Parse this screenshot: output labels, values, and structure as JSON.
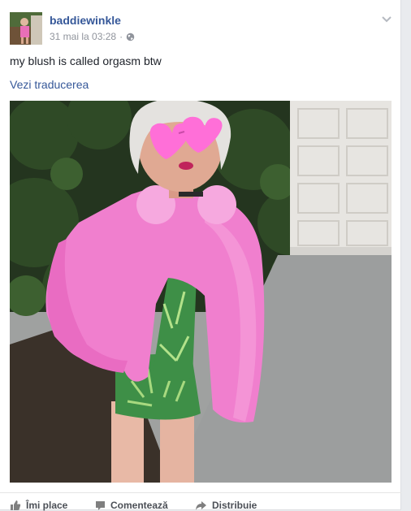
{
  "post": {
    "author": "baddiewinkle",
    "timestamp": "31 mai la 03:28",
    "separator": "·",
    "privacy_icon": "globe-icon",
    "menu_icon": "chevron-down-icon",
    "text": "my blush is called orgasm btw",
    "translate_link": "Vezi traducerea"
  },
  "actions": {
    "like_label": "Îmi place",
    "comment_label": "Comentează",
    "share_label": "Distribuie"
  },
  "colors": {
    "link": "#365899",
    "meta": "#90949c",
    "action": "#4b4f56",
    "jacket_pink": "#f07fce",
    "heart_glasses": "#ff6fd8",
    "swimsuit_green": "#3e8f47",
    "garage_door": "#eceae6"
  }
}
